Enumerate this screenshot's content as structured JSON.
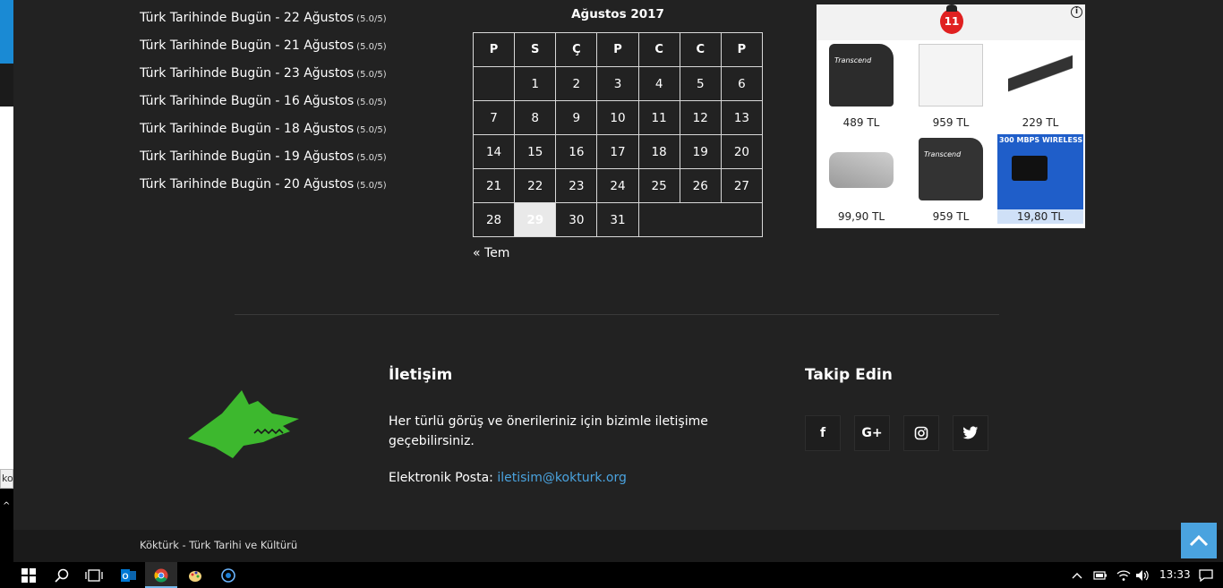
{
  "edge": {
    "tooltip_fragment": "kok"
  },
  "posts": [
    {
      "title": "Türk Tarihinde Bugün - 22 Ağustos",
      "rating": "(5.0/5)"
    },
    {
      "title": "Türk Tarihinde Bugün - 21 Ağustos",
      "rating": "(5.0/5)"
    },
    {
      "title": "Türk Tarihinde Bugün - 23 Ağustos",
      "rating": "(5.0/5)"
    },
    {
      "title": "Türk Tarihinde Bugün - 16 Ağustos",
      "rating": "(5.0/5)"
    },
    {
      "title": "Türk Tarihinde Bugün - 18 Ağustos",
      "rating": "(5.0/5)"
    },
    {
      "title": "Türk Tarihinde Bugün - 19 Ağustos",
      "rating": "(5.0/5)"
    },
    {
      "title": "Türk Tarihinde Bugün - 20 Ağustos",
      "rating": "(5.0/5)"
    }
  ],
  "calendar": {
    "caption": "Ağustos 2017",
    "weekdays": [
      "P",
      "S",
      "Ç",
      "P",
      "C",
      "C",
      "P"
    ],
    "weeks": [
      [
        "",
        "1",
        "2",
        "3",
        "4",
        "5",
        "6"
      ],
      [
        "7",
        "8",
        "9",
        "10",
        "11",
        "12",
        "13"
      ],
      [
        "14",
        "15",
        "16",
        "17",
        "18",
        "19",
        "20"
      ],
      [
        "21",
        "22",
        "23",
        "24",
        "25",
        "26",
        "27"
      ],
      [
        "28",
        "29",
        "30",
        "31",
        "",
        "",
        ""
      ]
    ],
    "today": "29",
    "prev_link": "« Tem"
  },
  "ad": {
    "logo_text": "11",
    "info_icon": "info-icon",
    "products": [
      {
        "price": "489 TL",
        "label": "Transcend"
      },
      {
        "price": "959 TL",
        "label": ""
      },
      {
        "price": "229 TL",
        "label": ""
      },
      {
        "price": "99,90 TL",
        "label": ""
      },
      {
        "price": "959 TL",
        "label": "Transcend"
      },
      {
        "price": "19,80 TL",
        "label": "300 MBPS WIRELESS"
      }
    ]
  },
  "footer": {
    "contact_title": "İletişim",
    "contact_desc": "Her türlü görüş ve önerileriniz için bizimle iletişime geçebilirsiniz.",
    "email_label": "Elektronik Posta: ",
    "email": "iletisim@kokturk.org",
    "follow_title": "Takip Edin",
    "social": [
      {
        "icon": "facebook-icon",
        "glyph": "f"
      },
      {
        "icon": "google-plus-icon",
        "glyph": "G+"
      },
      {
        "icon": "instagram-icon",
        "glyph": "◎"
      },
      {
        "icon": "twitter-icon",
        "glyph": "🐦"
      }
    ],
    "copyright": "Köktürk - Türk Tarihi ve Kültürü"
  },
  "taskbar": {
    "clock": "13:33"
  },
  "colors": {
    "accent": "#4aa3df",
    "background": "#222222",
    "logo_green": "#3db82e"
  }
}
